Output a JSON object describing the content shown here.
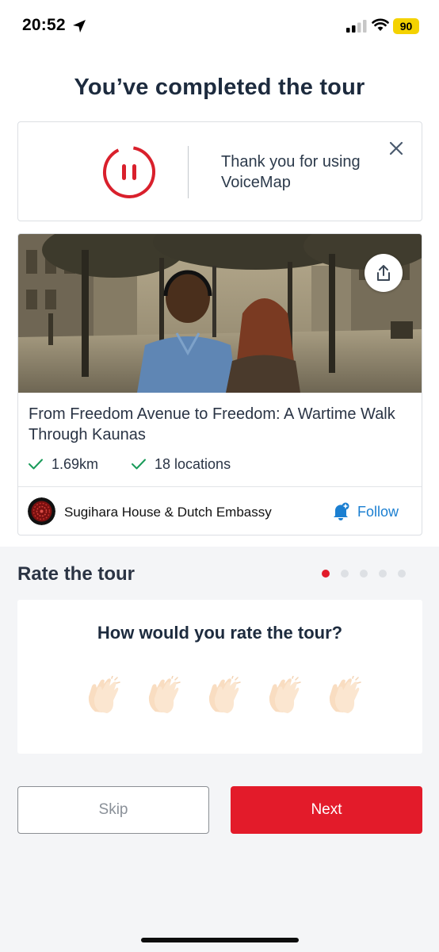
{
  "status_bar": {
    "time": "20:52",
    "battery": "90",
    "icons": [
      "location-arrow-icon",
      "signal-icon",
      "wifi-icon",
      "battery-icon"
    ]
  },
  "page": {
    "title": "You’ve completed the tour"
  },
  "completion_card": {
    "message": "Thank you for using VoiceMap",
    "icons": [
      "pause-icon",
      "close-icon"
    ],
    "accent_color": "#d9202c"
  },
  "tour": {
    "title": "From Freedom Avenue to Freedom: A Wartime Walk Through Kaunas",
    "distance": "1.69km",
    "locations": "18 locations",
    "author": "Sugihara House & Dutch Embassy",
    "follow_label": "Follow",
    "icons": [
      "share-icon",
      "check-icon",
      "bell-plus-icon"
    ],
    "check_color": "#1a9b5a",
    "link_color": "#1b7fd1"
  },
  "rating": {
    "heading": "Rate the tour",
    "question": "How would you rate the tour?",
    "max_rating": 5,
    "current_rating": 0,
    "rating_icon": "clapping-hands-icon",
    "pager": {
      "total": 5,
      "active": 1
    }
  },
  "actions": {
    "skip_label": "Skip",
    "next_label": "Next",
    "primary_color": "#e31b2a"
  }
}
